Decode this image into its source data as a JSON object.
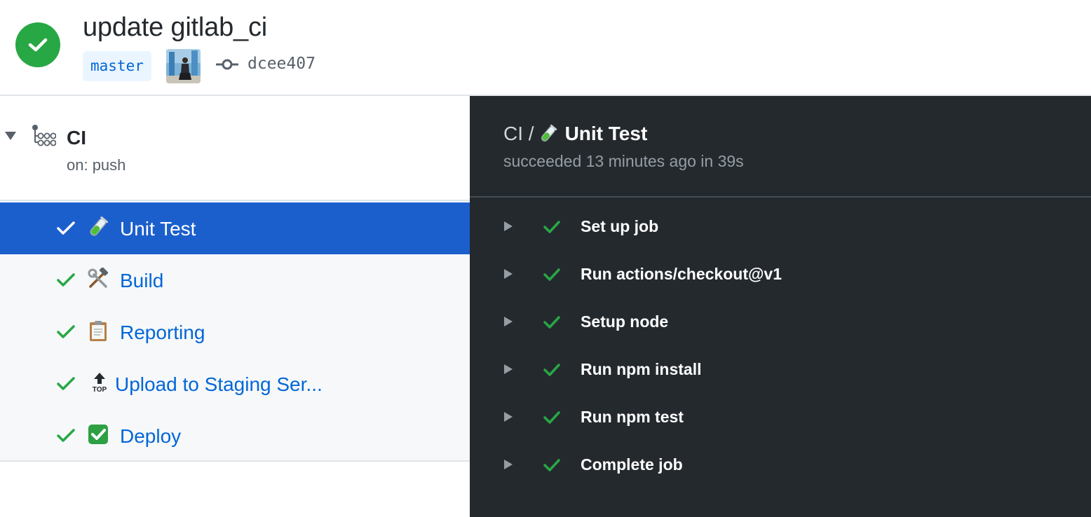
{
  "header": {
    "commit_title": "update gitlab_ci",
    "branch": "master",
    "commit_sha": "dcee407",
    "status": "success",
    "status_icon": "check-icon",
    "status_color": "#28a745"
  },
  "workflow": {
    "name": "CI",
    "trigger": "on: push",
    "icon": "workflow-icon"
  },
  "jobs": [
    {
      "label": "Unit Test",
      "emoji": "test-tube-icon",
      "status": "success",
      "selected": true
    },
    {
      "label": "Build",
      "emoji": "hammer-and-wrench-icon",
      "status": "success",
      "selected": false
    },
    {
      "label": "Reporting",
      "emoji": "clipboard-icon",
      "status": "success",
      "selected": false
    },
    {
      "label": "Upload to Staging Ser...",
      "emoji": "top-arrow-icon",
      "status": "success",
      "selected": false
    },
    {
      "label": "Deploy",
      "emoji": "check-mark-button-icon",
      "status": "success",
      "selected": false
    }
  ],
  "job_detail": {
    "workflow_crumb": "CI /",
    "job_name": "Unit Test",
    "status_text": "succeeded 13 minutes ago in 39s",
    "steps": [
      {
        "label": "Set up job",
        "status": "success"
      },
      {
        "label": "Run actions/checkout@v1",
        "status": "success"
      },
      {
        "label": "Setup node",
        "status": "success"
      },
      {
        "label": "Run npm install",
        "status": "success"
      },
      {
        "label": "Run npm test",
        "status": "success"
      },
      {
        "label": "Complete job",
        "status": "success"
      }
    ]
  },
  "colors": {
    "success_green": "#28a745",
    "link_blue": "#0366d6",
    "selected_blue": "#1b5fcd",
    "log_background": "#24292e"
  }
}
